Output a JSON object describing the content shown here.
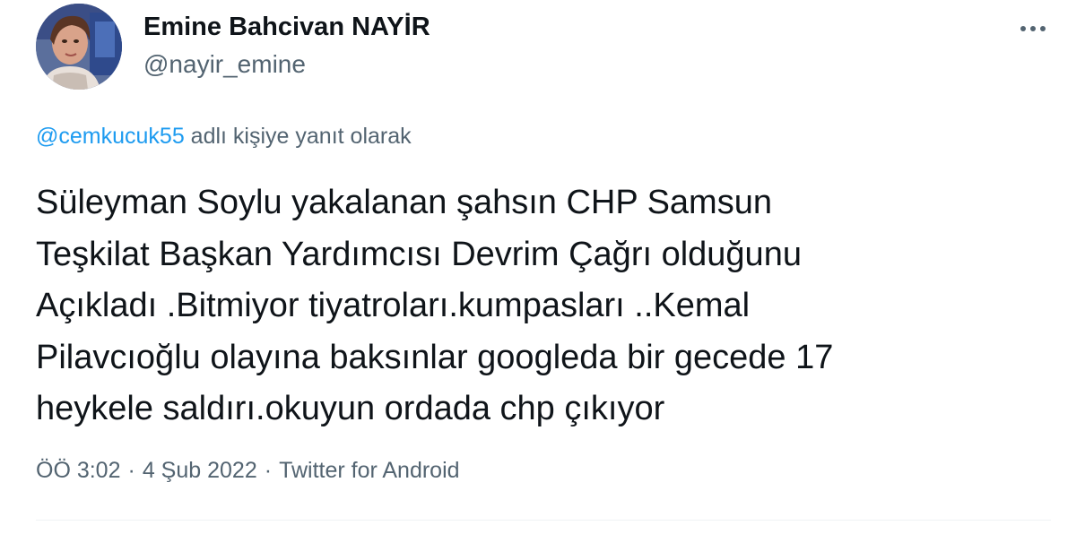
{
  "author": {
    "display_name": "Emine Bahcivan NAYİR",
    "handle": "@nayir_emine",
    "avatar_icon": "profile-photo"
  },
  "more_icon": "more-horizontal-icon",
  "reply": {
    "mention": "@cemkucuk55",
    "suffix": " adlı kişiye yanıt olarak"
  },
  "tweet": {
    "lines": [
      "Süleyman Soylu yakalanan şahsın CHP Samsun",
      "Teşkilat Başkan Yardımcısı Devrim Çağrı olduğunu",
      "Açıkladı .Bitmiyor tiyatroları.kumpasları ..Kemal",
      "Pilavcıoğlu olayına baksınlar googleda bir gecede 17",
      "heykele saldırı.okuyun ordada chp çıkıyor"
    ]
  },
  "meta": {
    "time": "ÖÖ 3:02",
    "separator": "·",
    "date": "4 Şub 2022",
    "source": "Twitter for Android"
  },
  "colors": {
    "text": "#0f1419",
    "secondary": "#536471",
    "link": "#1d9bf0",
    "divider": "#eff3f4"
  }
}
